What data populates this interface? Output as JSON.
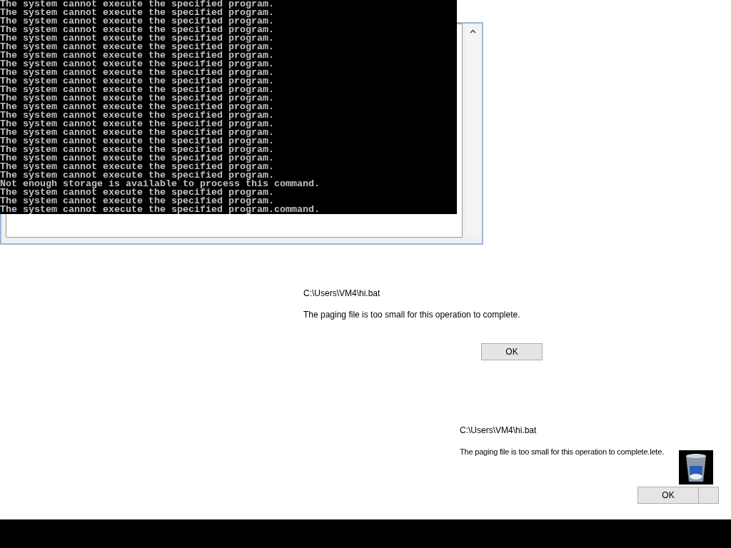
{
  "console": {
    "lines": [
      "The system cannot execute the specified program.",
      "The system cannot execute the specified program.",
      "The system cannot execute the specified program.",
      "The system cannot execute the specified program.",
      "The system cannot execute the specified program.",
      "The system cannot execute the specified program.",
      "The system cannot execute the specified program.",
      "The system cannot execute the specified program.",
      "The system cannot execute the specified program.",
      "The system cannot execute the specified program.",
      "The system cannot execute the specified program.",
      "The system cannot execute the specified program.",
      "The system cannot execute the specified program.",
      "The system cannot execute the specified program.",
      "The system cannot execute the specified program.",
      "The system cannot execute the specified program.",
      "The system cannot execute the specified program.",
      "The system cannot execute the specified program.",
      "The system cannot execute the specified program.",
      "The system cannot execute the specified program.",
      "The system cannot execute the specified program.",
      "Not enough storage is available to process this command.",
      "The system cannot execute the specified program.",
      "The system cannot execute the specified program.",
      "The system cannot execute the specified program.command."
    ]
  },
  "dialogs": [
    {
      "path": "C:\\Users\\VM4\\hi.bat",
      "message": "The paging file is too small for this operation to complete.",
      "button": "OK"
    },
    {
      "path": "C:\\Users\\VM4\\hi.bat",
      "message": "The paging file is too small for this operation to complete.lete.",
      "button": "OK"
    }
  ]
}
